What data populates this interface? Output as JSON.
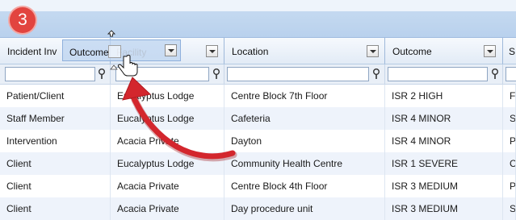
{
  "step_badge": "3",
  "drag": {
    "label": "Outcome",
    "faint_label": "Facility"
  },
  "columns": [
    {
      "label": "Incident Inv"
    },
    {
      "label": ""
    },
    {
      "label": "Location"
    },
    {
      "label": "Outcome"
    },
    {
      "label": "S"
    }
  ],
  "rows": [
    [
      "Patient/Client",
      "Eucalyptus Lodge",
      "Centre Block 7th Floor",
      "ISR 2 HIGH",
      "F"
    ],
    [
      "Staff Member",
      "Eucalyptus Lodge",
      "Cafeteria",
      "ISR 4 MINOR",
      "S"
    ],
    [
      "Intervention",
      "Acacia Private",
      "Dayton",
      "ISR 4 MINOR",
      "P"
    ],
    [
      "Client",
      "Eucalyptus Lodge",
      "Community Health Centre",
      "ISR 1 SEVERE",
      "C"
    ],
    [
      "Client",
      "Acacia Private",
      "Centre Block 4th Floor",
      "ISR 3 MEDIUM",
      "P"
    ],
    [
      "Client",
      "Acacia Private",
      "Day procedure unit",
      "ISR 3 MEDIUM",
      "S"
    ]
  ],
  "colors": {
    "accent_badge": "#e2443f",
    "arrow": "#d3262d",
    "group_bar": "#c4d9f0",
    "alt_row": "#eef3fb"
  },
  "icons": [
    "filter-icon",
    "dropdown-arrow-icon",
    "hand-cursor-icon",
    "move-cursor-icon",
    "curved-arrow-icon"
  ]
}
